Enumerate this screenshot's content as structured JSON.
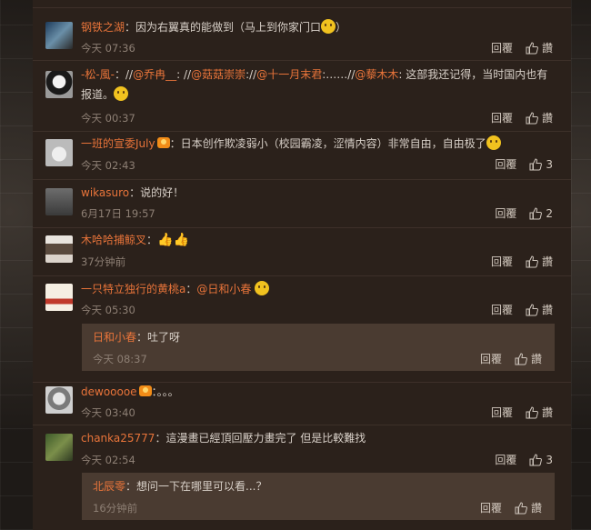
{
  "comments": [
    {
      "user": "钢铁之湖",
      "text": "：因为右翼真的能做到（马上到你家门口",
      "text_after": "）",
      "time": "今天 07:36",
      "reply_label": "回覆",
      "like_label": "讚"
    },
    {
      "user": "-松-風-",
      "text": "：//",
      "mention1": "@乔冉__",
      "sep1": ": //",
      "mention2": "@菇菇崇崇",
      "sep2": "://",
      "mention3": "@十一月末君",
      "sep3": ":……//",
      "mention4": "@藜木木",
      "text_end": ": 这部我还记得，当时国内也有报道。",
      "time": "今天 00:37",
      "reply_label": "回覆",
      "like_label": "讚"
    },
    {
      "user": "一班的宣委July",
      "text": "：日本创作欺凌弱小（校园霸凌，涩情内容）非常自由，自由极了",
      "time": "今天 02:43",
      "reply_label": "回覆",
      "like_count": "3"
    },
    {
      "user": "wikasuro",
      "text": "：说的好！",
      "time": "6月17日 19:57",
      "reply_label": "回覆",
      "like_count": "2"
    },
    {
      "user": "木哈哈捕鲸叉",
      "text": "：",
      "emoji": "👍👍",
      "time": "37分钟前",
      "reply_label": "回覆",
      "like_label": "讚"
    },
    {
      "user": "一只特立独行的黄桃a",
      "text": "：",
      "mention": "@日和小春",
      "time": "今天 05:30",
      "reply_label": "回覆",
      "like_label": "讚",
      "sub_reply": {
        "user": "日和小春",
        "text": "：吐了呀",
        "time": "今天 08:37",
        "reply_label": "回覆",
        "like_label": "讚"
      }
    },
    {
      "user": "dewooooe",
      "text": "：。。。",
      "time": "今天 03:40",
      "reply_label": "回覆",
      "like_label": "讚"
    },
    {
      "user": "chanka25777",
      "text": "：這漫畫已經頂回壓力畫完了 但是比較難找",
      "time": "今天 02:54",
      "reply_label": "回覆",
      "like_count": "3",
      "sub_reply": {
        "user": "北辰零",
        "text": "：想问一下在哪里可以看...？",
        "time": "16分钟前",
        "reply_label": "回覆",
        "like_label": "讚"
      }
    }
  ],
  "colors": {
    "panel_bg": "#2b211b",
    "username": "#e8743a",
    "text": "#d8d0c8",
    "meta": "#8d7f74",
    "sub_reply_bg": "#4a3b31"
  }
}
